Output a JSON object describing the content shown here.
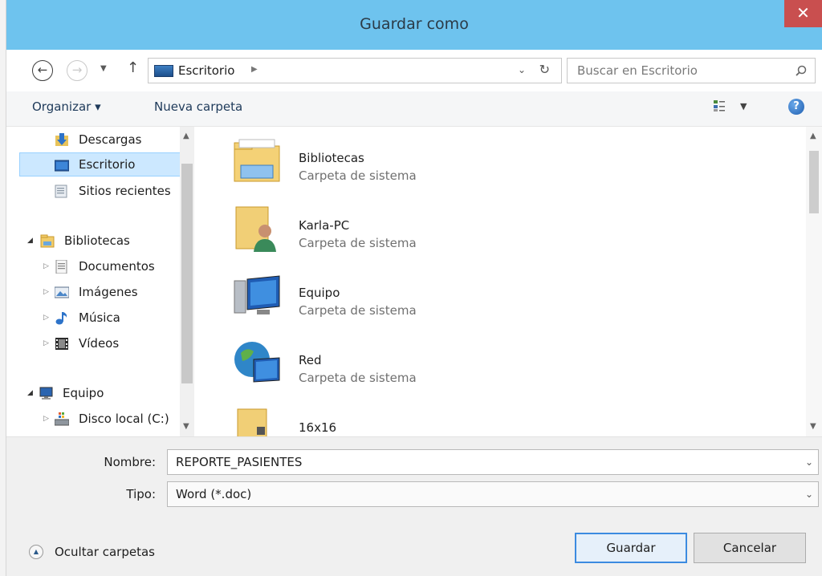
{
  "window": {
    "title": "Guardar como",
    "close_glyph": "✕"
  },
  "address": {
    "path_label": "Escritorio",
    "search_placeholder": "Buscar en Escritorio"
  },
  "toolbar": {
    "organize_label": "Organizar ▾",
    "new_folder_label": "Nueva carpeta",
    "help_glyph": "?"
  },
  "sidebar": {
    "items": [
      {
        "label": "Descargas",
        "icon": "downloads-icon"
      },
      {
        "label": "Escritorio",
        "icon": "desktop-icon",
        "selected": true
      },
      {
        "label": "Sitios recientes",
        "icon": "recent-places-icon"
      },
      {
        "label": "Bibliotecas",
        "icon": "libraries-icon"
      },
      {
        "label": "Documentos",
        "icon": "documents-icon"
      },
      {
        "label": "Imágenes",
        "icon": "pictures-icon"
      },
      {
        "label": "Música",
        "icon": "music-icon"
      },
      {
        "label": "Vídeos",
        "icon": "videos-icon"
      },
      {
        "label": "Equipo",
        "icon": "computer-icon"
      },
      {
        "label": "Disco local (C:)",
        "icon": "local-disk-icon"
      }
    ]
  },
  "content": {
    "items": [
      {
        "name": "Bibliotecas",
        "type": "Carpeta de sistema",
        "icon": "libraries-folder-icon"
      },
      {
        "name": "Karla-PC",
        "type": "Carpeta de sistema",
        "icon": "user-folder-icon"
      },
      {
        "name": "Equipo",
        "type": "Carpeta de sistema",
        "icon": "computer-icon"
      },
      {
        "name": "Red",
        "type": "Carpeta de sistema",
        "icon": "network-icon"
      },
      {
        "name": "16x16",
        "type": "",
        "icon": "folder-icon"
      }
    ]
  },
  "form": {
    "filename_label": "Nombre:",
    "filename_value": "REPORTE_PASIENTES",
    "filetype_label": "Tipo:",
    "filetype_value": "Word (*.doc)"
  },
  "footer": {
    "hide_folders_label": "Ocultar carpetas",
    "save_label": "Guardar",
    "cancel_label": "Cancelar"
  },
  "colors": {
    "titlebar": "#6ec3ee",
    "close": "#c94f4f",
    "selection": "#cce8ff",
    "primary_border": "#3c8be0"
  }
}
